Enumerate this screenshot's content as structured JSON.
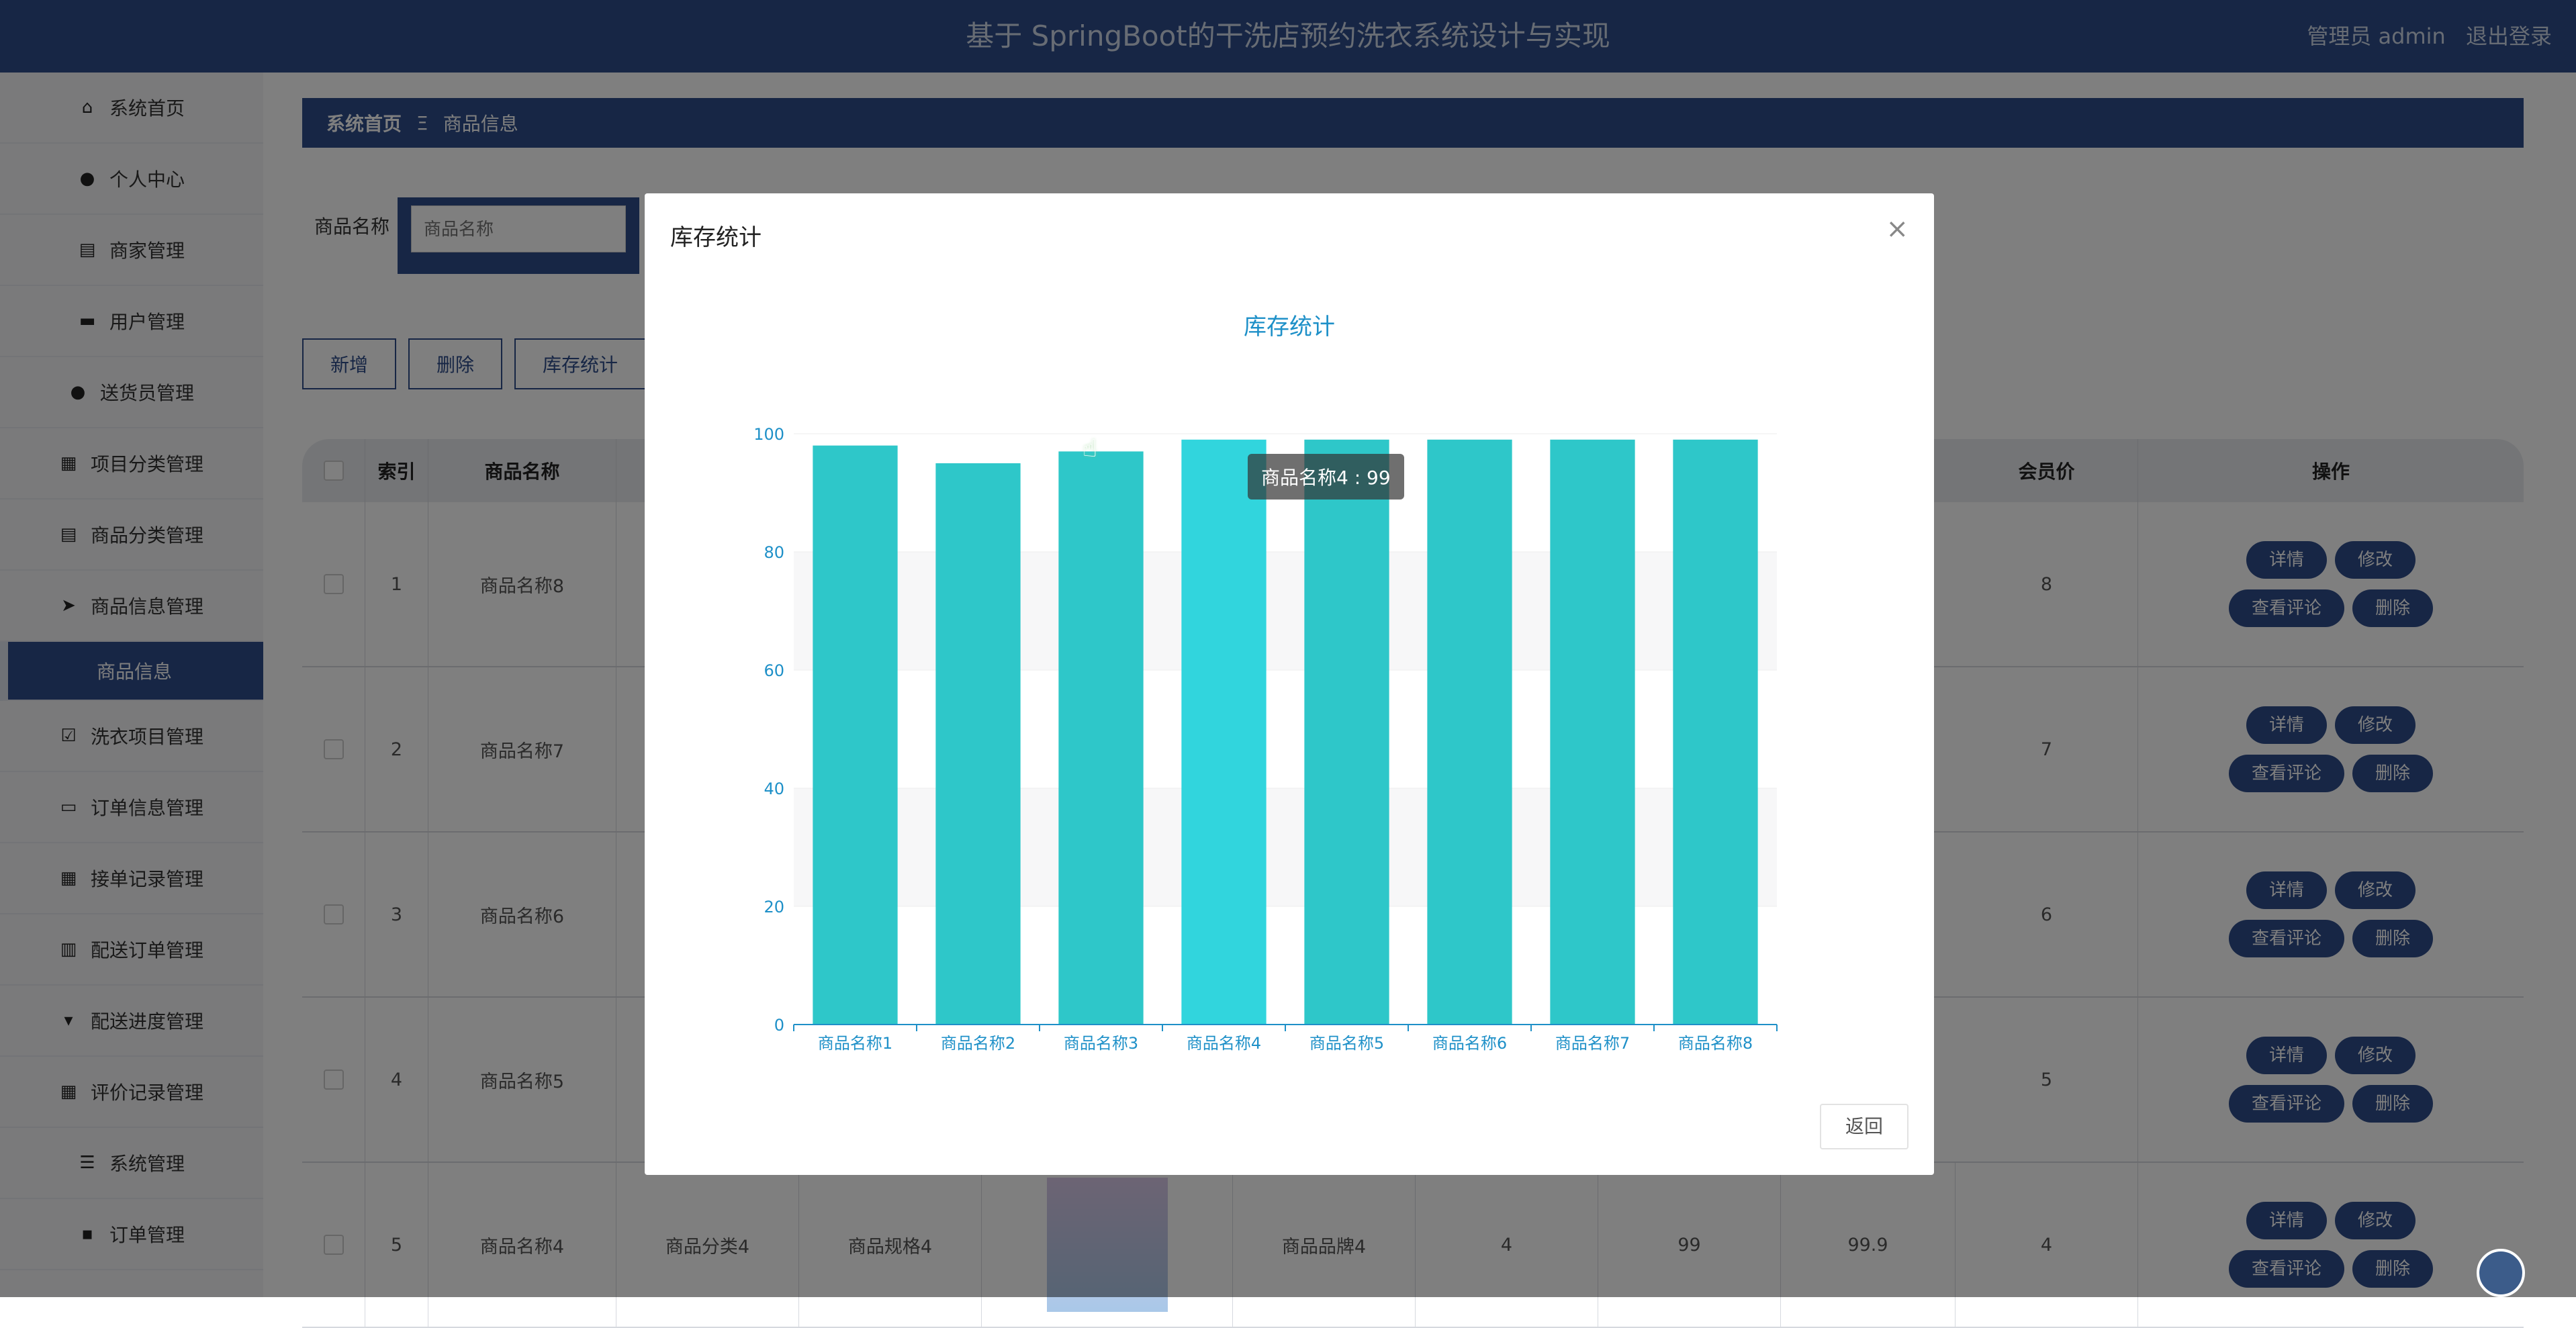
{
  "header": {
    "title": "基于 SpringBoot的干洗店预约洗衣系统设计与实现",
    "user": "管理员 admin",
    "logout": "退出登录"
  },
  "sidebar": {
    "items": [
      {
        "label": "系统首页",
        "icon": "home-icon"
      },
      {
        "label": "个人中心",
        "icon": "user-icon"
      },
      {
        "label": "商家管理",
        "icon": "chart-icon"
      },
      {
        "label": "用户管理",
        "icon": "users-icon"
      },
      {
        "label": "送货员管理",
        "icon": "pin-icon"
      },
      {
        "label": "项目分类管理",
        "icon": "grid-icon"
      },
      {
        "label": "商品分类管理",
        "icon": "clipboard-icon"
      },
      {
        "label": "商品信息管理",
        "icon": "send-icon"
      },
      {
        "label": "商品信息",
        "icon": "",
        "sub": true
      },
      {
        "label": "洗衣项目管理",
        "icon": "check-icon"
      },
      {
        "label": "订单信息管理",
        "icon": "briefcase-icon"
      },
      {
        "label": "接单记录管理",
        "icon": "grid-icon"
      },
      {
        "label": "配送订单管理",
        "icon": "bars-icon"
      },
      {
        "label": "配送进度管理",
        "icon": "cup-icon"
      },
      {
        "label": "评价记录管理",
        "icon": "grid-icon"
      },
      {
        "label": "系统管理",
        "icon": "sliders-icon"
      },
      {
        "label": "订单管理",
        "icon": "message-icon"
      }
    ]
  },
  "breadcrumb": {
    "home": "系统首页",
    "sep": "Ξ",
    "current": "商品信息"
  },
  "search": {
    "label": "商品名称",
    "placeholder": "商品名称"
  },
  "actions": {
    "add": "新增",
    "delete": "删除",
    "stock": "库存统计"
  },
  "table": {
    "headers": {
      "index": "索引",
      "name": "商品名称",
      "member_price": "会员价",
      "ops": "操作"
    },
    "rows": [
      {
        "index": "1",
        "name": "商品名称8",
        "member_price": "8"
      },
      {
        "index": "2",
        "name": "商品名称7",
        "member_price": "7"
      },
      {
        "index": "3",
        "name": "商品名称6",
        "member_price": "6"
      },
      {
        "index": "4",
        "name": "商品名称5",
        "member_price": "5"
      },
      {
        "index": "5",
        "name": "商品名称4",
        "category": "商品分类4",
        "spec": "商品规格4",
        "brand": "商品品牌4",
        "c1": "4",
        "c2": "99",
        "c3": "99.9",
        "member_price": "4"
      }
    ],
    "ops": {
      "detail": "详情",
      "edit": "修改",
      "comments": "查看评论",
      "delete": "删除"
    }
  },
  "modal": {
    "title": "库存统计",
    "close": "×",
    "back": "返回"
  },
  "tooltip": "商品名称4 : 99",
  "colors": {
    "primary": "#2f4d8a",
    "bar": "#2ec7c9",
    "bar_hover": "#31d5dd",
    "axis": "#1e90c8"
  },
  "chart_data": {
    "type": "bar",
    "title": "库存统计",
    "categories": [
      "商品名称1",
      "商品名称2",
      "商品名称3",
      "商品名称4",
      "商品名称5",
      "商品名称6",
      "商品名称7",
      "商品名称8"
    ],
    "values": [
      98,
      95,
      97,
      99,
      99,
      99,
      99,
      99
    ],
    "ylim": [
      0,
      100
    ],
    "yticks": [
      0,
      20,
      40,
      60,
      80,
      100
    ],
    "highlight_index": 3
  }
}
